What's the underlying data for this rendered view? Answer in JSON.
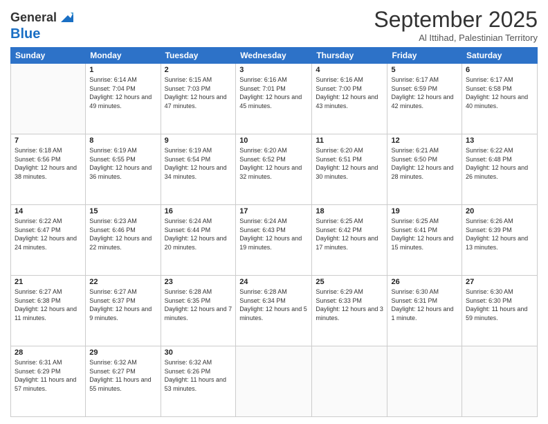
{
  "header": {
    "logo_line1": "General",
    "logo_line2": "Blue",
    "month_title": "September 2025",
    "subtitle": "Al Ittihad, Palestinian Territory"
  },
  "days_of_week": [
    "Sunday",
    "Monday",
    "Tuesday",
    "Wednesday",
    "Thursday",
    "Friday",
    "Saturday"
  ],
  "weeks": [
    [
      {
        "day": "",
        "empty": true
      },
      {
        "day": "1",
        "sunrise": "6:14 AM",
        "sunset": "7:04 PM",
        "daylight": "12 hours and 49 minutes."
      },
      {
        "day": "2",
        "sunrise": "6:15 AM",
        "sunset": "7:03 PM",
        "daylight": "12 hours and 47 minutes."
      },
      {
        "day": "3",
        "sunrise": "6:16 AM",
        "sunset": "7:01 PM",
        "daylight": "12 hours and 45 minutes."
      },
      {
        "day": "4",
        "sunrise": "6:16 AM",
        "sunset": "7:00 PM",
        "daylight": "12 hours and 43 minutes."
      },
      {
        "day": "5",
        "sunrise": "6:17 AM",
        "sunset": "6:59 PM",
        "daylight": "12 hours and 42 minutes."
      },
      {
        "day": "6",
        "sunrise": "6:17 AM",
        "sunset": "6:58 PM",
        "daylight": "12 hours and 40 minutes."
      }
    ],
    [
      {
        "day": "7",
        "sunrise": "6:18 AM",
        "sunset": "6:56 PM",
        "daylight": "12 hours and 38 minutes."
      },
      {
        "day": "8",
        "sunrise": "6:19 AM",
        "sunset": "6:55 PM",
        "daylight": "12 hours and 36 minutes."
      },
      {
        "day": "9",
        "sunrise": "6:19 AM",
        "sunset": "6:54 PM",
        "daylight": "12 hours and 34 minutes."
      },
      {
        "day": "10",
        "sunrise": "6:20 AM",
        "sunset": "6:52 PM",
        "daylight": "12 hours and 32 minutes."
      },
      {
        "day": "11",
        "sunrise": "6:20 AM",
        "sunset": "6:51 PM",
        "daylight": "12 hours and 30 minutes."
      },
      {
        "day": "12",
        "sunrise": "6:21 AM",
        "sunset": "6:50 PM",
        "daylight": "12 hours and 28 minutes."
      },
      {
        "day": "13",
        "sunrise": "6:22 AM",
        "sunset": "6:48 PM",
        "daylight": "12 hours and 26 minutes."
      }
    ],
    [
      {
        "day": "14",
        "sunrise": "6:22 AM",
        "sunset": "6:47 PM",
        "daylight": "12 hours and 24 minutes."
      },
      {
        "day": "15",
        "sunrise": "6:23 AM",
        "sunset": "6:46 PM",
        "daylight": "12 hours and 22 minutes."
      },
      {
        "day": "16",
        "sunrise": "6:24 AM",
        "sunset": "6:44 PM",
        "daylight": "12 hours and 20 minutes."
      },
      {
        "day": "17",
        "sunrise": "6:24 AM",
        "sunset": "6:43 PM",
        "daylight": "12 hours and 19 minutes."
      },
      {
        "day": "18",
        "sunrise": "6:25 AM",
        "sunset": "6:42 PM",
        "daylight": "12 hours and 17 minutes."
      },
      {
        "day": "19",
        "sunrise": "6:25 AM",
        "sunset": "6:41 PM",
        "daylight": "12 hours and 15 minutes."
      },
      {
        "day": "20",
        "sunrise": "6:26 AM",
        "sunset": "6:39 PM",
        "daylight": "12 hours and 13 minutes."
      }
    ],
    [
      {
        "day": "21",
        "sunrise": "6:27 AM",
        "sunset": "6:38 PM",
        "daylight": "12 hours and 11 minutes."
      },
      {
        "day": "22",
        "sunrise": "6:27 AM",
        "sunset": "6:37 PM",
        "daylight": "12 hours and 9 minutes."
      },
      {
        "day": "23",
        "sunrise": "6:28 AM",
        "sunset": "6:35 PM",
        "daylight": "12 hours and 7 minutes."
      },
      {
        "day": "24",
        "sunrise": "6:28 AM",
        "sunset": "6:34 PM",
        "daylight": "12 hours and 5 minutes."
      },
      {
        "day": "25",
        "sunrise": "6:29 AM",
        "sunset": "6:33 PM",
        "daylight": "12 hours and 3 minutes."
      },
      {
        "day": "26",
        "sunrise": "6:30 AM",
        "sunset": "6:31 PM",
        "daylight": "12 hours and 1 minute."
      },
      {
        "day": "27",
        "sunrise": "6:30 AM",
        "sunset": "6:30 PM",
        "daylight": "11 hours and 59 minutes."
      }
    ],
    [
      {
        "day": "28",
        "sunrise": "6:31 AM",
        "sunset": "6:29 PM",
        "daylight": "11 hours and 57 minutes."
      },
      {
        "day": "29",
        "sunrise": "6:32 AM",
        "sunset": "6:27 PM",
        "daylight": "11 hours and 55 minutes."
      },
      {
        "day": "30",
        "sunrise": "6:32 AM",
        "sunset": "6:26 PM",
        "daylight": "11 hours and 53 minutes."
      },
      {
        "day": "",
        "empty": true
      },
      {
        "day": "",
        "empty": true
      },
      {
        "day": "",
        "empty": true
      },
      {
        "day": "",
        "empty": true
      }
    ]
  ]
}
